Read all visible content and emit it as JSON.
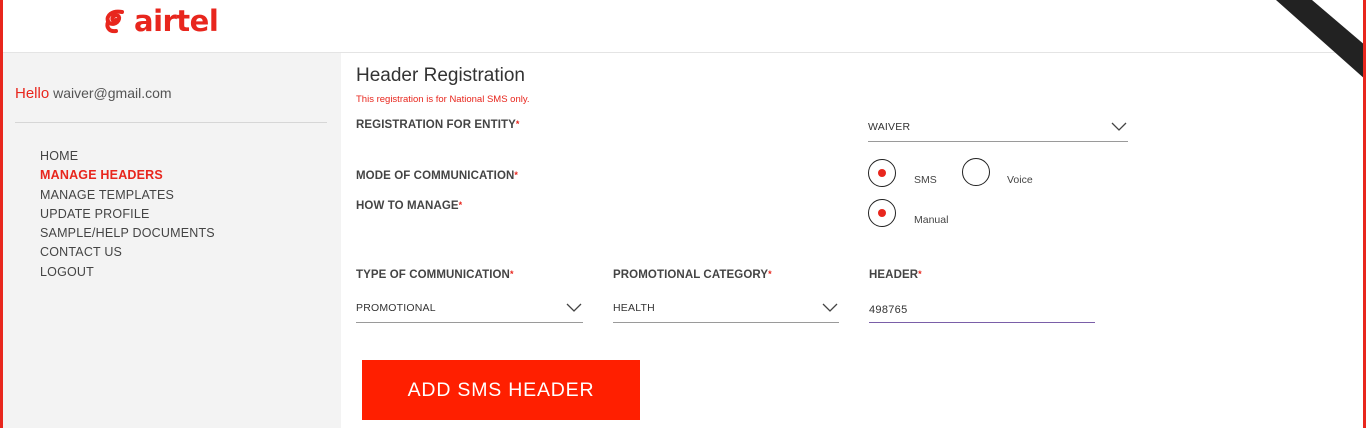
{
  "brand": {
    "name": "airtel",
    "color": "#e8261d",
    "logo_icon": "airtel-swirl-icon"
  },
  "sidebar": {
    "greeting": "Hello",
    "user_email": "waiver@gmail.com",
    "items": [
      {
        "label": "HOME",
        "active": false
      },
      {
        "label": "MANAGE HEADERS",
        "active": true
      },
      {
        "label": "MANAGE TEMPLATES",
        "active": false
      },
      {
        "label": "UPDATE PROFILE",
        "active": false
      },
      {
        "label": "SAMPLE/HELP DOCUMENTS",
        "active": false
      },
      {
        "label": "CONTACT US",
        "active": false
      },
      {
        "label": "LOGOUT",
        "active": false
      }
    ]
  },
  "form": {
    "title": "Header Registration",
    "subtitle": "This registration is for National SMS only.",
    "entity": {
      "label": "REGISTRATION FOR ENTITY",
      "value": "WAIVER"
    },
    "mode": {
      "label": "MODE OF COMMUNICATION",
      "options": [
        "SMS",
        "Voice"
      ],
      "selected": "SMS"
    },
    "manage": {
      "label": "HOW TO MANAGE",
      "options": [
        "Manual"
      ],
      "selected": "Manual"
    },
    "type": {
      "label": "TYPE OF COMMUNICATION",
      "value": "PROMOTIONAL"
    },
    "category": {
      "label": "PROMOTIONAL CATEGORY",
      "value": "HEALTH"
    },
    "header": {
      "label": "HEADER",
      "value": "498765"
    },
    "required_mark": "*",
    "submit_label": "ADD SMS HEADER"
  },
  "colors": {
    "accent": "#e8261d",
    "button": "#ff1f00",
    "sidebar_bg": "#f3f3f3",
    "input_focus": "#7a5ea8"
  }
}
